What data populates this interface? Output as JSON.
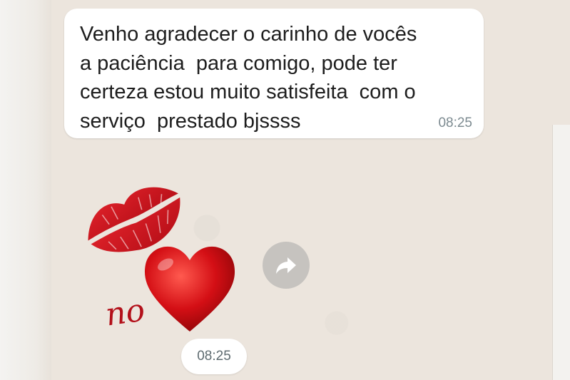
{
  "message": {
    "text": "Venho agradecer o carinho de vocês\na paciência  para comigo, pode ter\ncerteza estou muito satisfeita  com o\nserviço  prestado bjssss",
    "time": "08:25"
  },
  "sticker": {
    "icon": "kiss-lips-heart-sticker",
    "caption": "no",
    "lip_color": "#c9151e",
    "heart_color": "#d40f15"
  },
  "forward_button": {
    "icon": "forward-arrow-icon"
  },
  "sticker_message": {
    "time": "08:25"
  },
  "colors": {
    "background": "#ece5dd",
    "bubble": "#ffffff",
    "forward_button": "#c6c3bf"
  }
}
